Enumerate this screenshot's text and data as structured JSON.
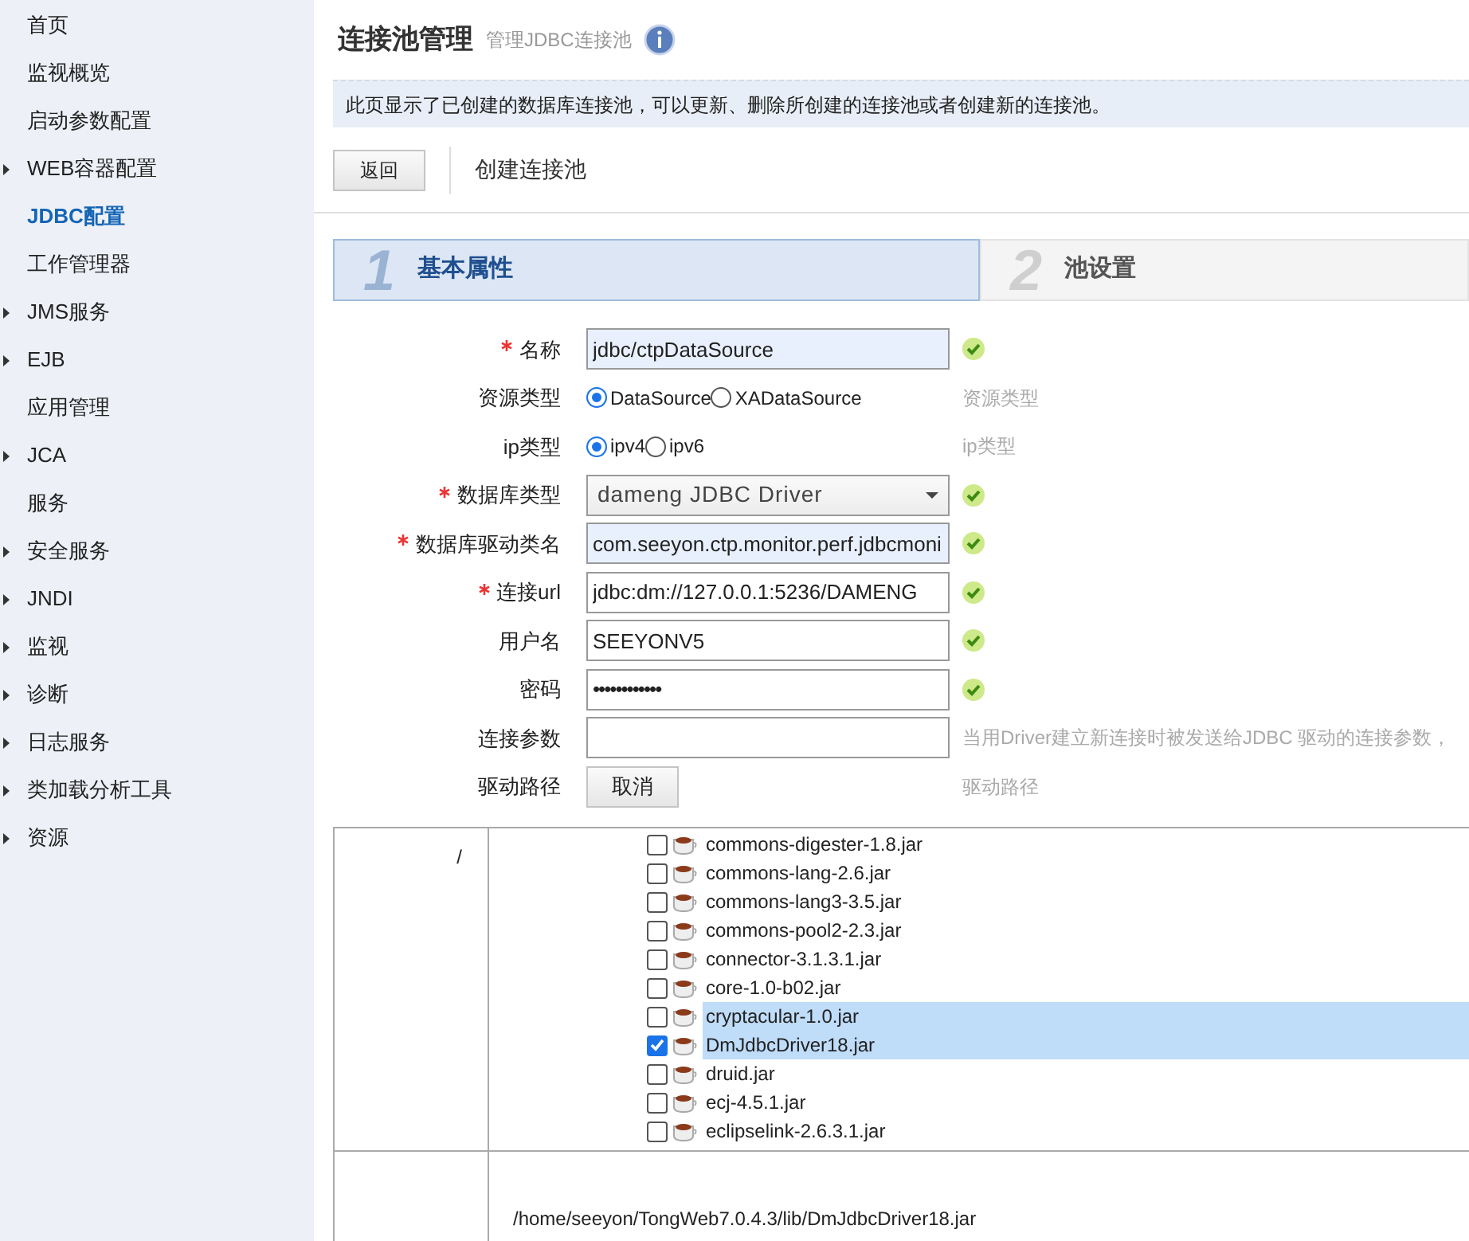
{
  "sidebar": {
    "items": [
      {
        "label": "首页",
        "expandable": false,
        "selected": false
      },
      {
        "label": "监视概览",
        "expandable": false,
        "selected": false
      },
      {
        "label": "启动参数配置",
        "expandable": false,
        "selected": false
      },
      {
        "label": "WEB容器配置",
        "expandable": true,
        "selected": false
      },
      {
        "label": "JDBC配置",
        "expandable": false,
        "selected": true
      },
      {
        "label": "工作管理器",
        "expandable": false,
        "selected": false
      },
      {
        "label": "JMS服务",
        "expandable": true,
        "selected": false
      },
      {
        "label": "EJB",
        "expandable": true,
        "selected": false
      },
      {
        "label": "应用管理",
        "expandable": false,
        "selected": false
      },
      {
        "label": "JCA",
        "expandable": true,
        "selected": false
      },
      {
        "label": "服务",
        "expandable": false,
        "selected": false
      },
      {
        "label": "安全服务",
        "expandable": true,
        "selected": false
      },
      {
        "label": "JNDI",
        "expandable": true,
        "selected": false
      },
      {
        "label": "监视",
        "expandable": true,
        "selected": false
      },
      {
        "label": "诊断",
        "expandable": true,
        "selected": false
      },
      {
        "label": "日志服务",
        "expandable": true,
        "selected": false
      },
      {
        "label": "类加载分析工具",
        "expandable": true,
        "selected": false
      },
      {
        "label": "资源",
        "expandable": true,
        "selected": false
      }
    ]
  },
  "header": {
    "title": "连接池管理",
    "subtitle": "管理JDBC连接池",
    "info": "此页显示了已创建的数据库连接池，可以更新、删除所创建的连接池或者创建新的连接池。"
  },
  "toolbar": {
    "back_button": "返回",
    "page_title": "创建连接池"
  },
  "steps": [
    {
      "number": "1",
      "label": "基本属性",
      "selected": true
    },
    {
      "number": "2",
      "label": "池设置",
      "selected": false
    }
  ],
  "form": [
    {
      "kind": "text",
      "label": "名称",
      "required": true,
      "value": "jdbc/ctpDataSource",
      "focused": true,
      "valid": true
    },
    {
      "kind": "radio",
      "label": "资源类型",
      "required": false,
      "options": [
        {
          "label": "DataSource",
          "selected": true
        },
        {
          "label": "XADataSource",
          "selected": false
        }
      ],
      "hint": "资源类型"
    },
    {
      "kind": "radio",
      "label": "ip类型",
      "required": false,
      "options": [
        {
          "label": "ipv4",
          "selected": true
        },
        {
          "label": "ipv6",
          "selected": false
        }
      ],
      "hint": "ip类型"
    },
    {
      "kind": "select",
      "label": "数据库类型",
      "required": true,
      "value": "dameng JDBC Driver",
      "valid": true
    },
    {
      "kind": "text",
      "label": "数据库驱动类名",
      "required": true,
      "value": "com.seeyon.ctp.monitor.perf.jdbcmoni",
      "focused": true,
      "valid": true
    },
    {
      "kind": "text",
      "label": "连接url",
      "required": true,
      "value": "jdbc:dm://127.0.0.1:5236/DAMENG",
      "focused": false,
      "valid": true
    },
    {
      "kind": "text",
      "label": "用户名",
      "required": false,
      "value": "SEEYONV5",
      "focused": false,
      "valid": true
    },
    {
      "kind": "password",
      "label": "密码",
      "required": false,
      "value": "••••••••••••",
      "valid": true
    },
    {
      "kind": "text",
      "label": "连接参数",
      "required": false,
      "focused": false,
      "hint": "当用Driver建立新连接时被发送给JDBC 驱动的连接参数，"
    },
    {
      "kind": "button",
      "label": "驱动路径",
      "required": false,
      "value": "取消",
      "hint": "驱动路径"
    }
  ],
  "file_browser": {
    "path_label": "/",
    "files": [
      {
        "name": "commons-digester-1.8.jar",
        "checked": false,
        "selected": false
      },
      {
        "name": "commons-lang-2.6.jar",
        "checked": false,
        "selected": false
      },
      {
        "name": "commons-lang3-3.5.jar",
        "checked": false,
        "selected": false
      },
      {
        "name": "commons-pool2-2.3.jar",
        "checked": false,
        "selected": false
      },
      {
        "name": "connector-3.1.3.1.jar",
        "checked": false,
        "selected": false
      },
      {
        "name": "core-1.0-b02.jar",
        "checked": false,
        "selected": false
      },
      {
        "name": "cryptacular-1.0.jar",
        "checked": false,
        "selected": true
      },
      {
        "name": "DmJdbcDriver18.jar",
        "checked": true,
        "selected": true
      },
      {
        "name": "druid.jar",
        "checked": false,
        "selected": false
      },
      {
        "name": "ecj-4.5.1.jar",
        "checked": false,
        "selected": false
      },
      {
        "name": "eclipselink-2.6.3.1.jar",
        "checked": false,
        "selected": false
      }
    ],
    "selected_path": "/home/seeyon/TongWeb7.0.4.3/lib/DmJdbcDriver18.jar"
  }
}
